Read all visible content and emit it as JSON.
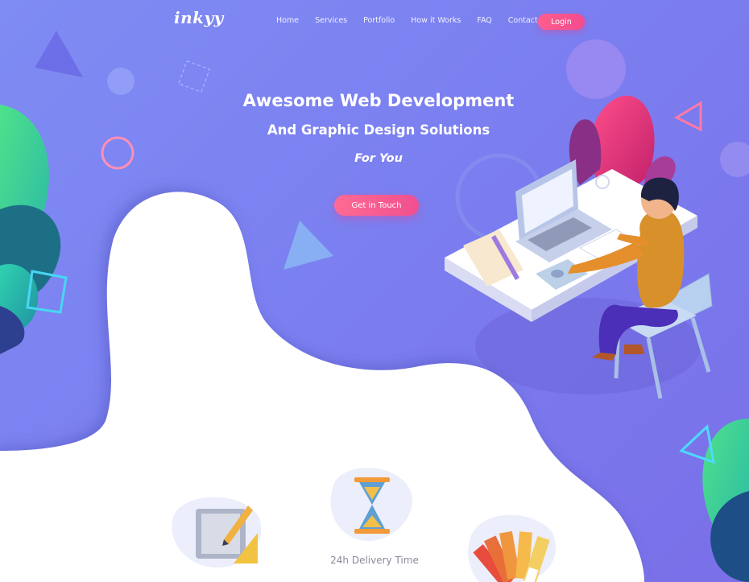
{
  "brand": {
    "logo_text": "inkyy"
  },
  "nav": {
    "items": [
      "Home",
      "Services",
      "Portfolio",
      "How it Works",
      "FAQ",
      "Contact Us"
    ],
    "login_label": "Login"
  },
  "hero": {
    "title": "Awesome Web Development",
    "subtitle": "And Graphic Design Solutions",
    "tagline": "For You",
    "cta_label": "Get in Touch"
  },
  "features": {
    "center_label": "24h Delivery Time"
  },
  "colors": {
    "primary_bg": "#7b7ff0",
    "accent_pink": "#f24b8f",
    "white": "#ffffff"
  }
}
